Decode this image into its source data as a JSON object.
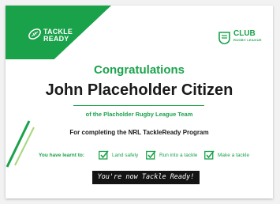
{
  "brand": {
    "tackleready_logo": {
      "line1": "TACKLE",
      "line2": "READY"
    }
  },
  "club_logo": {
    "name": "CLUB",
    "subtitle": "RUGBY LEAGUE"
  },
  "certificate": {
    "headline": "Congratulations",
    "recipient": "John Placeholder Citizen",
    "team_line": "of the Placholder Rugby League Team",
    "program_line": "For completing the NRL TackleReady Program",
    "skills_label": "You have learnt to:",
    "skills": [
      "Land safely",
      "Run into a tackle",
      "Make a tackle"
    ],
    "banner": "You're now Tackle Ready!"
  },
  "colors": {
    "accent": "#19a24a",
    "text": "#1a1a1a",
    "banner_bg": "#141414"
  },
  "icons": {
    "tackleready": "rugby-ball-icon",
    "club": "shield-icon",
    "skill_check": "checkbox-checked-icon"
  }
}
